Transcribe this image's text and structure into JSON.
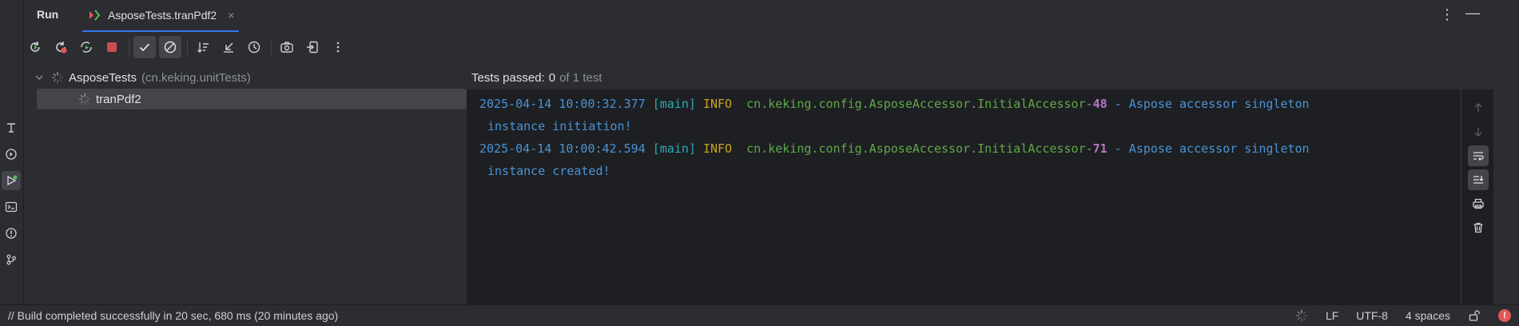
{
  "header": {
    "run_title": "Run",
    "tab_label": "AsposeTests.tranPdf2",
    "tab_close": "×",
    "more": "⋮",
    "minimize": "—"
  },
  "tree": {
    "root_label": "AsposeTests",
    "root_package": "(cn.keking.unitTests)",
    "child_label": "tranPdf2"
  },
  "console": {
    "status_prefix": "Tests passed:",
    "passed": "0",
    "total_text": "of 1 test",
    "lines": [
      {
        "date": "2025-04-14 10:00:32.377",
        "thread": "[main]",
        "level": "INFO ",
        "pkg": "cn.keking.config.AsposeAccessor",
        "dot": ".",
        "cls": "InitialAccessor",
        "dash": "-",
        "line_no": "48",
        "msg": " - Aspose accessor singleton",
        "cont": "instance initiation!"
      },
      {
        "date": "2025-04-14 10:00:42.594",
        "thread": "[main]",
        "level": "INFO ",
        "pkg": "cn.keking.config.AsposeAccessor",
        "dot": ".",
        "cls": "InitialAccessor",
        "dash": "-",
        "line_no": "71",
        "msg": " - Aspose accessor singleton",
        "cont": "instance created!"
      }
    ]
  },
  "statusbar": {
    "message": "// Build completed successfully in 20 sec, 680 ms (20 minutes ago)",
    "line_ending": "LF",
    "encoding": "UTF-8",
    "indent": "4 spaces",
    "error_mark": "!"
  },
  "colors": {
    "accent": "#3574f0",
    "success": "#5fb865",
    "error": "#e55757",
    "stop": "#c94f4f"
  }
}
